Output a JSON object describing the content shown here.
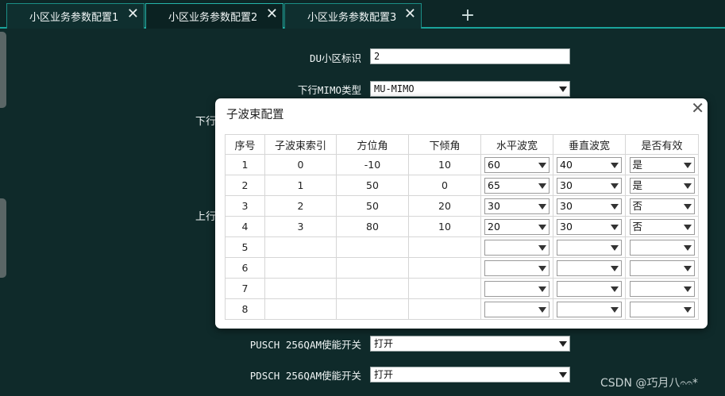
{
  "tabs": [
    {
      "label": "小区业务参数配置1",
      "active": false
    },
    {
      "label": "小区业务参数配置2",
      "active": true
    },
    {
      "label": "小区业务参数配置3",
      "active": false
    }
  ],
  "tab_close_glyph": "✕",
  "tab_add_glyph": "+",
  "form": {
    "du_cell_id": {
      "label": "DU小区标识",
      "value": "2"
    },
    "dl_mimo_type": {
      "label": "下行MIMO类型",
      "value": "MU-MIMO"
    },
    "partial_label_1": "下行",
    "partial_label_2": "上行",
    "pusch_256qam": {
      "label": "PUSCH 256QAM使能开关",
      "value": "打开"
    },
    "pdsch_256qam": {
      "label": "PDSCH 256QAM使能开关",
      "value": "打开"
    }
  },
  "dialog": {
    "title": "子波束配置",
    "close_glyph": "✕",
    "columns": [
      "序号",
      "子波束索引",
      "方位角",
      "下倾角",
      "水平波宽",
      "垂直波宽",
      "是否有效"
    ],
    "rows": [
      {
        "seq": "1",
        "index": "0",
        "azimuth": "-10",
        "tilt": "10",
        "h_width": "60",
        "v_width": "40",
        "valid": "是"
      },
      {
        "seq": "2",
        "index": "1",
        "azimuth": "50",
        "tilt": "0",
        "h_width": "65",
        "v_width": "30",
        "valid": "是"
      },
      {
        "seq": "3",
        "index": "2",
        "azimuth": "50",
        "tilt": "20",
        "h_width": "30",
        "v_width": "30",
        "valid": "否"
      },
      {
        "seq": "4",
        "index": "3",
        "azimuth": "80",
        "tilt": "10",
        "h_width": "20",
        "v_width": "30",
        "valid": "否"
      },
      {
        "seq": "5",
        "index": "",
        "azimuth": "",
        "tilt": "",
        "h_width": "",
        "v_width": "",
        "valid": ""
      },
      {
        "seq": "6",
        "index": "",
        "azimuth": "",
        "tilt": "",
        "h_width": "",
        "v_width": "",
        "valid": ""
      },
      {
        "seq": "7",
        "index": "",
        "azimuth": "",
        "tilt": "",
        "h_width": "",
        "v_width": "",
        "valid": ""
      },
      {
        "seq": "8",
        "index": "",
        "azimuth": "",
        "tilt": "",
        "h_width": "",
        "v_width": "",
        "valid": ""
      }
    ]
  },
  "watermark": "CSDN @巧月八𝄐𝄐*",
  "colors": {
    "background": "#0f2a2a",
    "tab_accent": "#1aa39a",
    "dialog_bg": "#ffffff"
  }
}
